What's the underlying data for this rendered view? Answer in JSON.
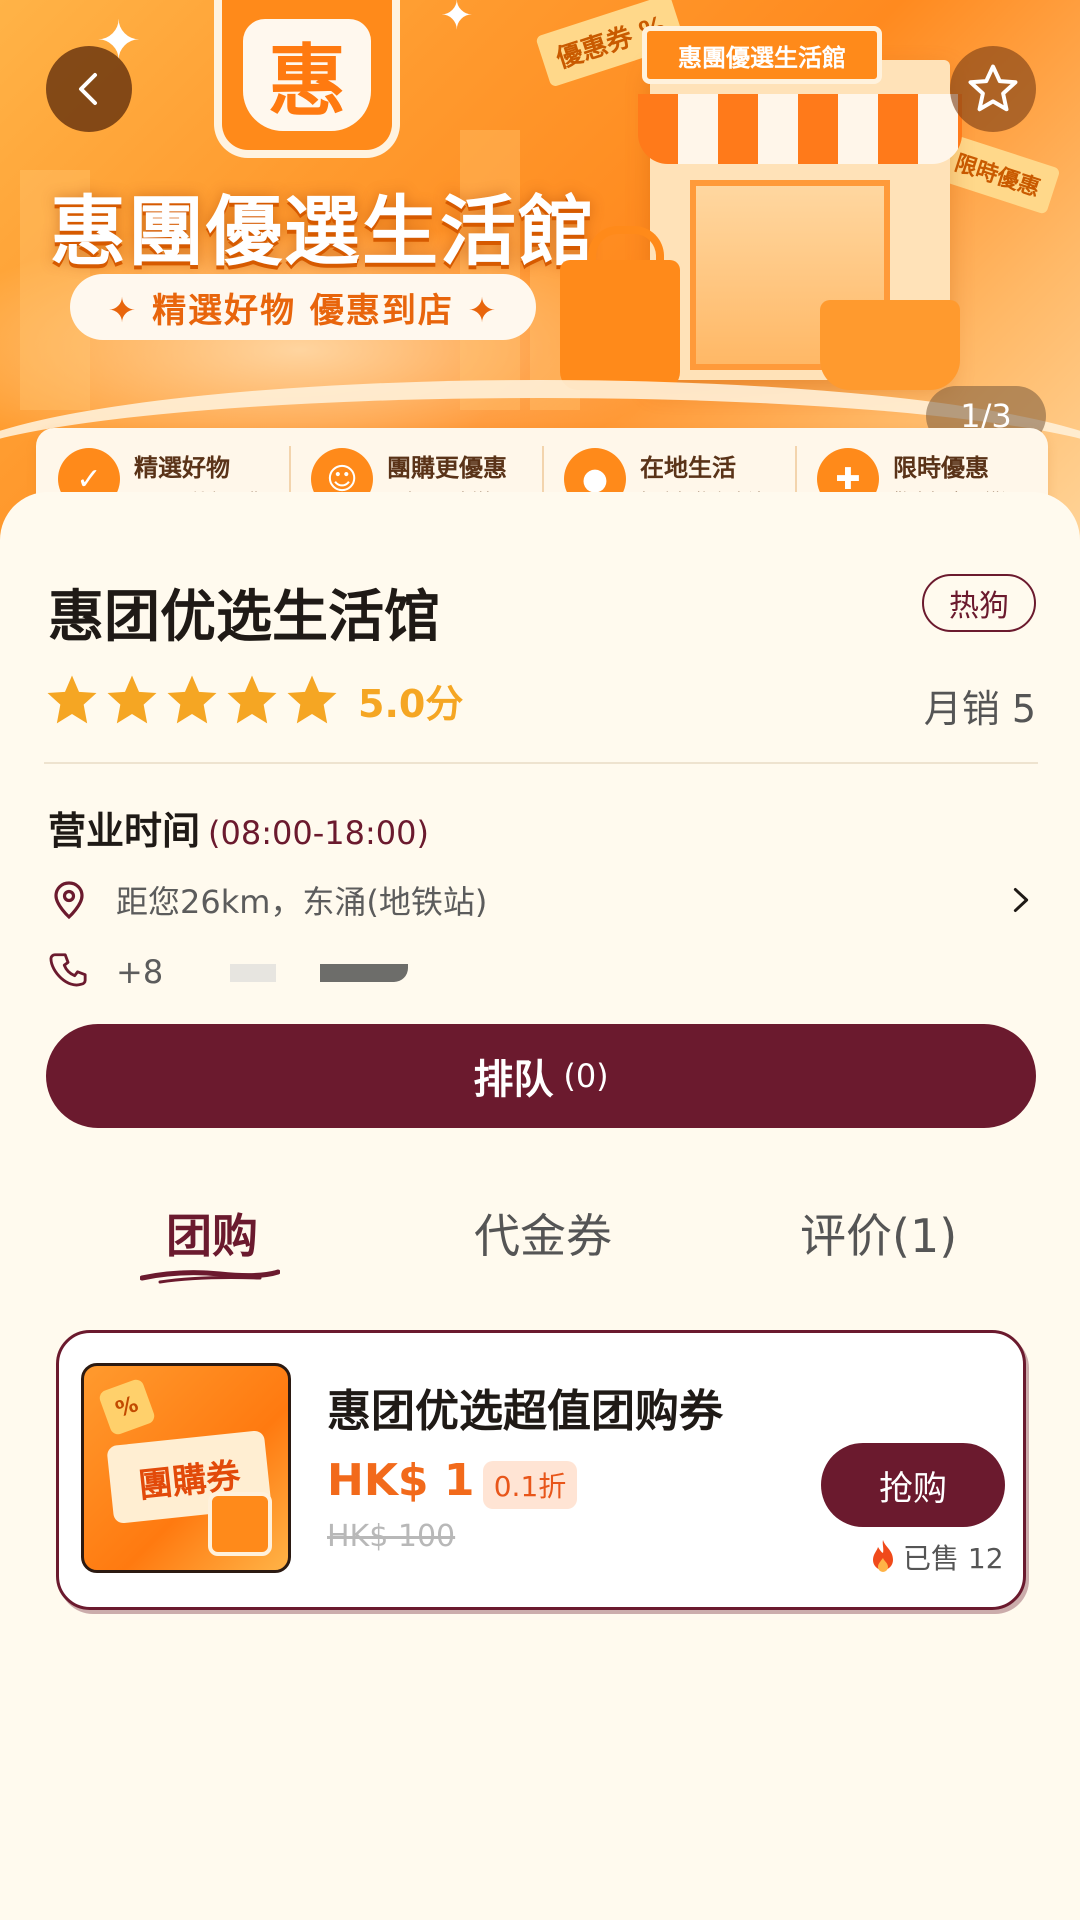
{
  "banner": {
    "logo_char": "惠",
    "title": "惠團優選生活館",
    "subtitle": "✦ 精選好物  優惠到店 ✦",
    "shop_sign": "惠團優選生活館",
    "coupon_tag": "優惠券 %",
    "limited_tag": "限時優惠",
    "page_indicator": "1/3",
    "features": [
      {
        "title": "精選好物",
        "sub": "嚴選品質安心購",
        "icon": "shield-icon"
      },
      {
        "title": "團購更優惠",
        "sub": "一起買更划算",
        "icon": "group-icon"
      },
      {
        "title": "在地生活",
        "sub": "好店好物在身邊",
        "icon": "location-pin-icon"
      },
      {
        "title": "限時優惠",
        "sub": "驚喜好康不錯過",
        "icon": "gift-icon"
      }
    ]
  },
  "shop": {
    "name": "惠团优选生活馆",
    "tag": "热狗",
    "rating": "5.0分",
    "stars": 5,
    "sales": "月销 5",
    "hours_label": "营业时间",
    "hours_value": "(08:00-18:00)",
    "address": "距您26km，东涌(地铁站)",
    "phone": "+8"
  },
  "queue": {
    "label": "排队",
    "count": "(0)"
  },
  "tabs": [
    {
      "label": "团购",
      "active": true
    },
    {
      "label": "代金券",
      "active": false
    },
    {
      "label": "评价(1)",
      "active": false
    }
  ],
  "deal": {
    "image_text": "團購券",
    "title": "惠团优选超值团购券",
    "price": "HK$ 1",
    "discount": "0.1折",
    "original_price": "HK$ 100",
    "buy_label": "抢购",
    "sold": "已售 12"
  },
  "colors": {
    "primary": "#6b1a2e",
    "accent_orange": "#f26a1b",
    "star": "#f5a623",
    "background": "#fffaee"
  }
}
